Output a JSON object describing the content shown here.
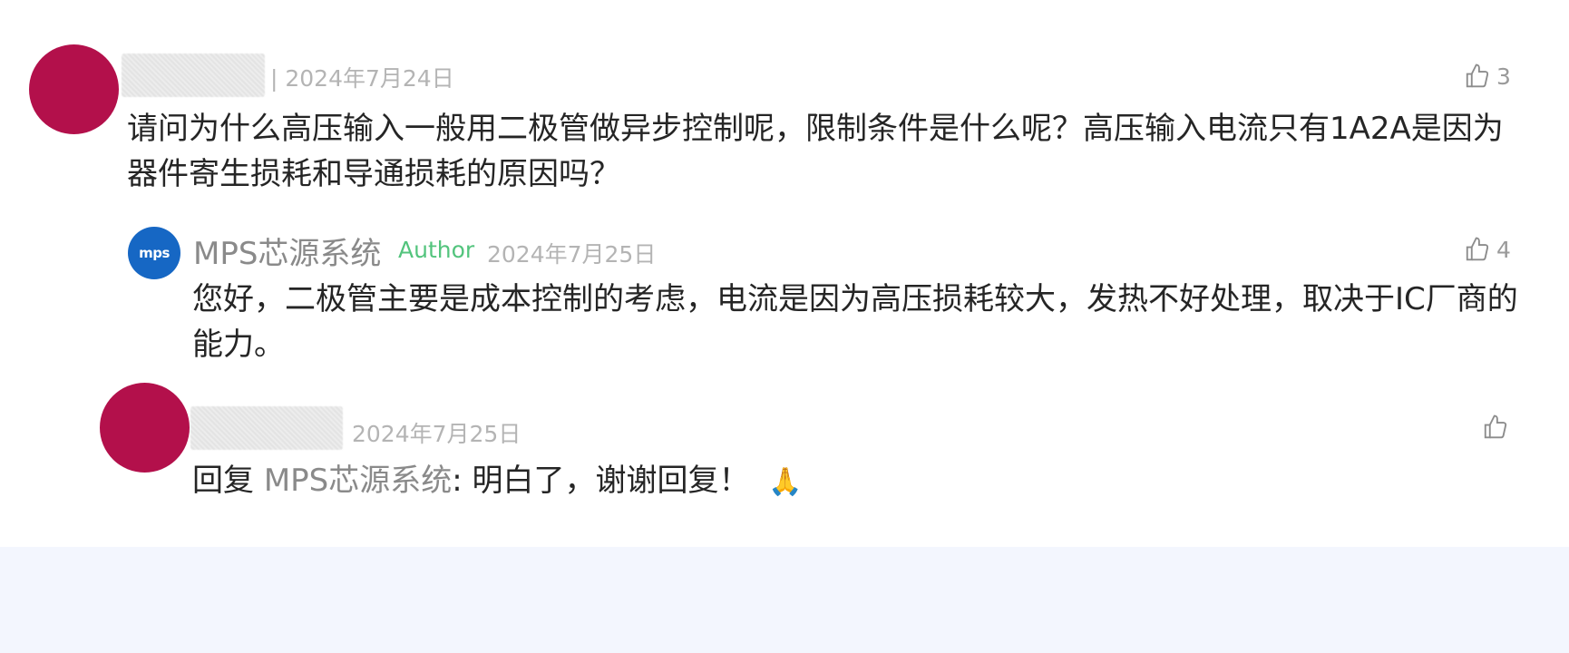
{
  "comments": [
    {
      "date": "| 2024年7月24日",
      "text": "请问为什么高压输入一般用二极管做异步控制呢，限制条件是什么呢？高压输入电流只有1A2A是因为器件寄生损耗和导通损耗的原因吗？",
      "likes": "3"
    }
  ],
  "reply": {
    "author_name": "MPS芯源系统",
    "author_tag": "Author",
    "date": "2024年7月25日",
    "logo_text": "mps",
    "text": "您好，二极管主要是成本控制的考虑，电流是因为高压损耗较大，发热不好处理，取决于IC厂商的能力。",
    "likes": "4"
  },
  "reply2": {
    "date": "2024年7月25日",
    "prefix": "回复",
    "mention": "MPS芯源系统",
    "separator": ":",
    "text": "明白了，谢谢回复！",
    "emoji": "🙏",
    "likes": ""
  },
  "colors": {
    "avatar": "#b3104b",
    "logo_blue": "#1667c4",
    "author_green": "#53c47d",
    "footer_bg": "#f3f6fe"
  },
  "icons": [
    "thumbs-up-icon"
  ]
}
